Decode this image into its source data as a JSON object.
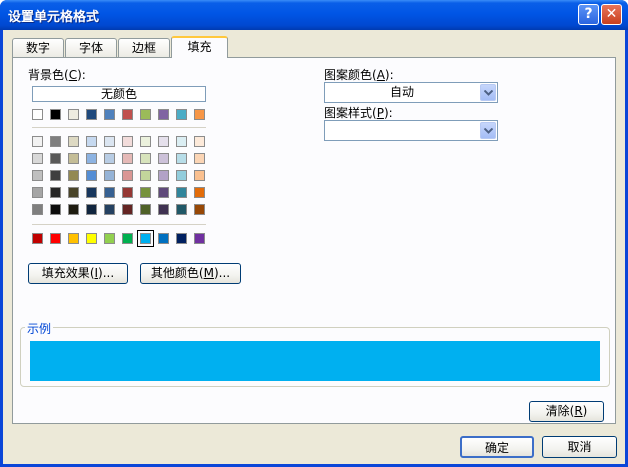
{
  "window": {
    "title": "设置单元格格式",
    "help_glyph": "?",
    "close_glyph": "✕"
  },
  "tabs": [
    {
      "label": "数字"
    },
    {
      "label": "字体"
    },
    {
      "label": "边框"
    },
    {
      "label": "填充",
      "active": true
    }
  ],
  "fill": {
    "background_label": "背景色",
    "background_key": "C",
    "no_color": "无颜色",
    "theme_row": [
      "#ffffff",
      "#000000",
      "#eeece1",
      "#1f497d",
      "#4f81bd",
      "#c0504d",
      "#9bbb59",
      "#8064a2",
      "#4bacc6",
      "#f79646"
    ],
    "shade_rows": [
      [
        "#f2f2f2",
        "#7f7f7f",
        "#ddd9c3",
        "#c6d9f0",
        "#dbe5f1",
        "#f2dcdb",
        "#ebf1dd",
        "#e5e0ec",
        "#dbeef3",
        "#fdeada"
      ],
      [
        "#d8d8d8",
        "#595959",
        "#c4bd97",
        "#8db3e2",
        "#b8cce4",
        "#e5b9b7",
        "#d7e3bc",
        "#ccc1d9",
        "#b7dde8",
        "#fbd5b5"
      ],
      [
        "#bfbfbf",
        "#3f3f3f",
        "#938953",
        "#548dd4",
        "#95b3d7",
        "#d99694",
        "#c3d69b",
        "#b2a2c7",
        "#92cddc",
        "#fac08f"
      ],
      [
        "#a5a5a5",
        "#262626",
        "#494429",
        "#17365d",
        "#366092",
        "#953734",
        "#76923c",
        "#5f497a",
        "#31859b",
        "#e36c09"
      ],
      [
        "#7f7f7f",
        "#0c0c0c",
        "#1d1b10",
        "#0f243e",
        "#244061",
        "#632423",
        "#4f6128",
        "#3f3151",
        "#205867",
        "#974806"
      ]
    ],
    "standard_row": [
      "#c00000",
      "#ff0000",
      "#ffc000",
      "#ffff00",
      "#92d050",
      "#00b050",
      "#00b0f0",
      "#0070c0",
      "#002060",
      "#7030a0"
    ],
    "selected_standard_index": 6,
    "fill_effects_button": {
      "label": "填充效果",
      "key": "I",
      "suffix": "..."
    },
    "more_colors_button": {
      "label": "其他颜色",
      "key": "M",
      "suffix": "..."
    },
    "pattern_color_label": "图案颜色",
    "pattern_color_key": "A",
    "pattern_color_value": "自动",
    "pattern_style_label": "图案样式",
    "pattern_style_key": "P",
    "pattern_style_value": "",
    "sample_label": "示例",
    "sample_color": "#00b0f0",
    "clear_button": {
      "label": "清除",
      "key": "R"
    }
  },
  "footer": {
    "ok_label": "确定",
    "cancel_label": "取消"
  },
  "colors": {
    "title_blue": "#0055e5",
    "dialog_face": "#ece9d8",
    "tab_highlight": "#ffc83c",
    "group_title": "#0046d5"
  }
}
